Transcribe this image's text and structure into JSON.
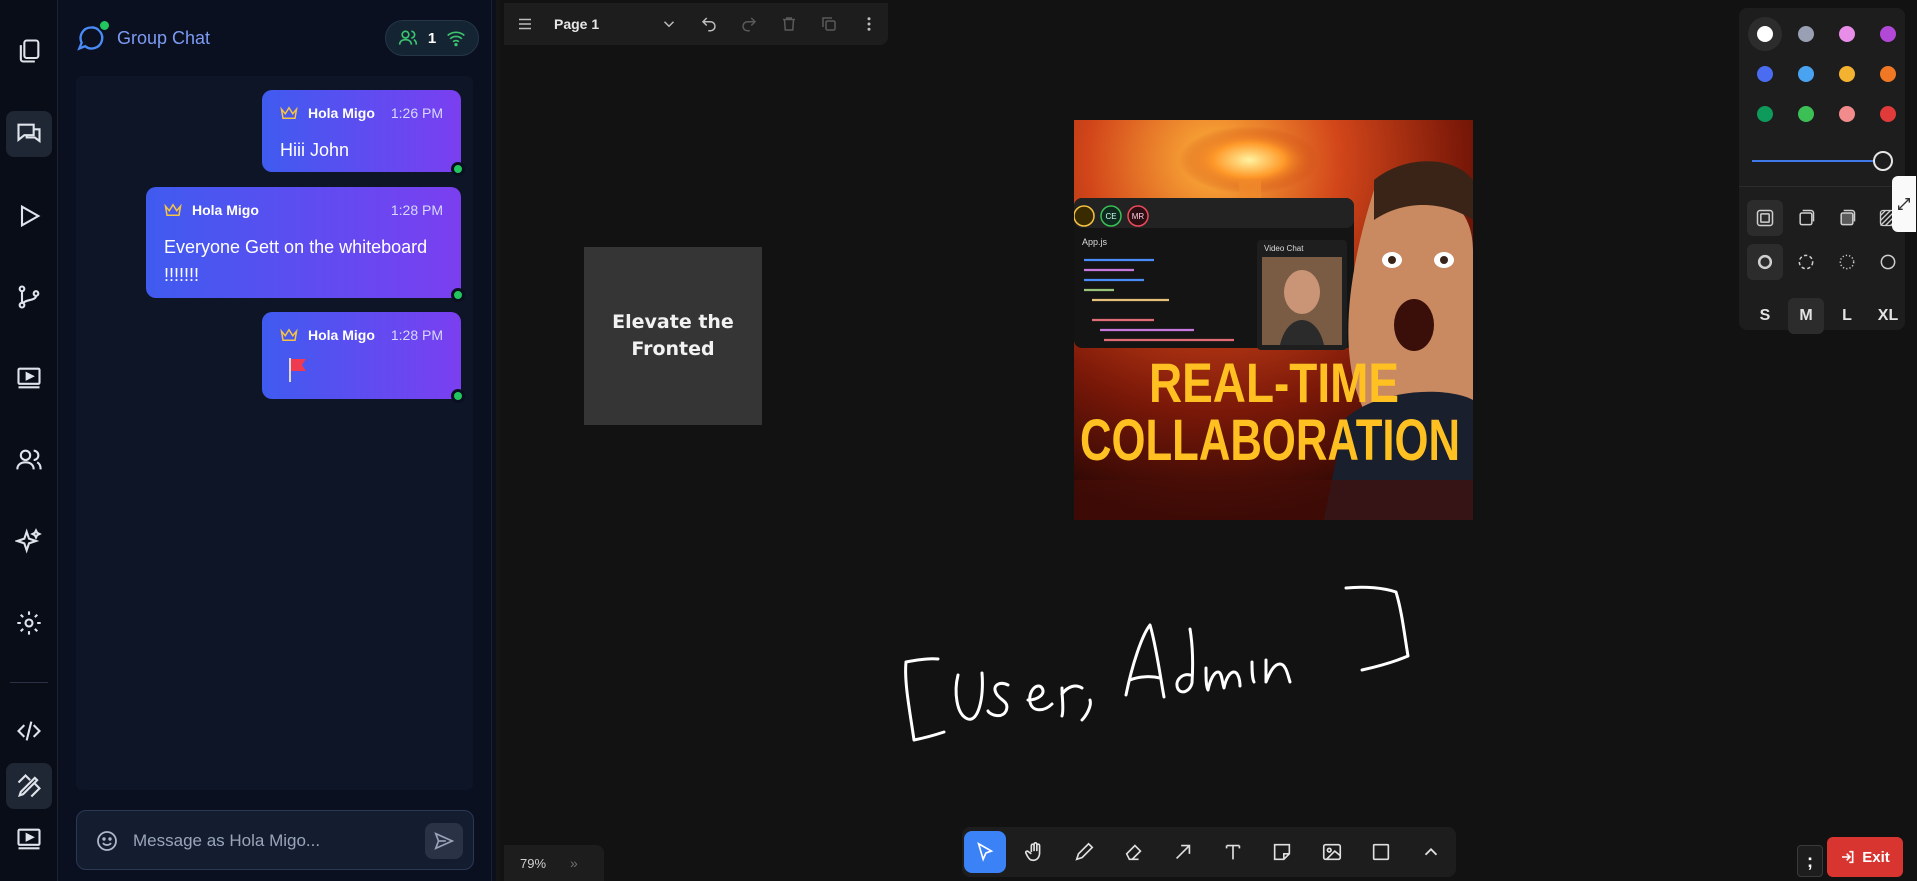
{
  "rail": {
    "items": [
      {
        "name": "pages",
        "icon": "copy-icon"
      },
      {
        "name": "chat",
        "icon": "chat-icon"
      },
      {
        "name": "run",
        "icon": "play-icon"
      },
      {
        "name": "git",
        "icon": "branch-icon"
      },
      {
        "name": "screen",
        "icon": "video-screen-icon"
      },
      {
        "name": "users",
        "icon": "users-icon"
      },
      {
        "name": "ai",
        "icon": "sparkles-icon"
      },
      {
        "name": "settings",
        "icon": "gear-icon"
      },
      {
        "name": "code",
        "icon": "code-icon"
      },
      {
        "name": "whiteboard",
        "icon": "pen-ruler-icon"
      },
      {
        "name": "media",
        "icon": "player-icon"
      }
    ]
  },
  "chat": {
    "title": "Group Chat",
    "online_count": "1",
    "messages": [
      {
        "author": "Hola Migo",
        "time": "1:26 PM",
        "text": "Hiii John"
      },
      {
        "author": "Hola Migo",
        "time": "1:28 PM",
        "text": "Everyone Gett on the whiteboard !!!!!!!"
      },
      {
        "author": "Hola Migo",
        "time": "1:28 PM",
        "text": "",
        "emoji": "red-flag-icon"
      }
    ],
    "composer_placeholder": "Message as Hola Migo..."
  },
  "board": {
    "page_name": "Page 1",
    "sticky_note": "Elevate the Fronted",
    "thumbnail": {
      "headline_line1": "REAL-TIME",
      "headline_line2": "COLLABORATION",
      "file_tab": "App.js",
      "video_tab": "Video Chat",
      "avatars": [
        "CE",
        "MR"
      ]
    },
    "handwriting": "[User, Admin ]",
    "zoom": "79%",
    "exit_label": "Exit",
    "corner_glyph": ";"
  },
  "style_panel": {
    "colors": [
      "#ffffff",
      "#9aa0b4",
      "#e88ee8",
      "#b148d6",
      "#4a6cf0",
      "#4aa3f0",
      "#f3b230",
      "#f07724",
      "#0e9a5a",
      "#3cbf55",
      "#f28b8b",
      "#e13a3a"
    ],
    "selected_color": "#ffffff",
    "opacity_percent": 100,
    "sizes": [
      "S",
      "M",
      "L",
      "XL"
    ],
    "selected_size": "M"
  },
  "tools": [
    "select-icon",
    "hand-icon",
    "pencil-icon",
    "eraser-icon",
    "arrow-icon",
    "text-icon",
    "note-icon",
    "image-icon",
    "rectangle-icon",
    "chevron-up-icon"
  ]
}
